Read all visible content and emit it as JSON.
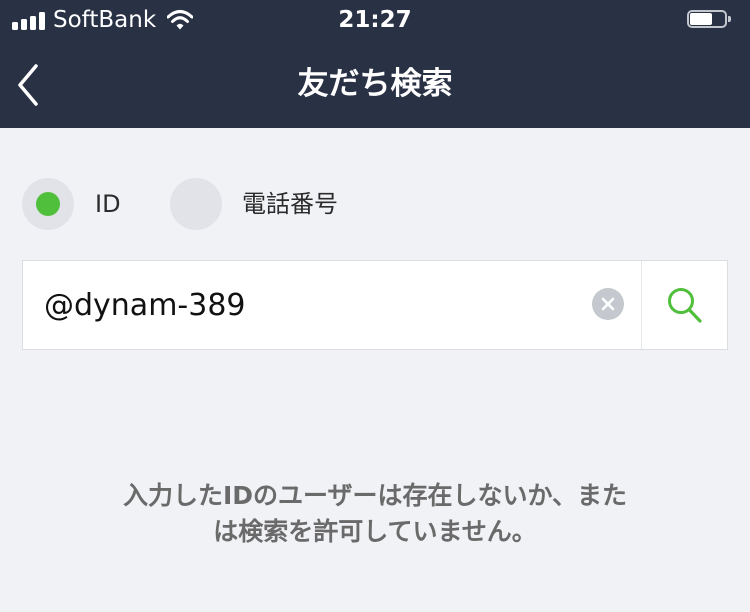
{
  "status_bar": {
    "carrier": "SoftBank",
    "time": "21:27",
    "icons": [
      "signal-icon",
      "wifi-icon",
      "battery-icon"
    ]
  },
  "header": {
    "title": "友だち検索",
    "back_icon": "chevron-left-icon"
  },
  "search_type": {
    "options": [
      {
        "label": "ID",
        "selected": true
      },
      {
        "label": "電話番号",
        "selected": false
      }
    ]
  },
  "search": {
    "value": "@dynam-389",
    "placeholder": "",
    "clear_icon": "clear-icon",
    "search_icon": "search-icon"
  },
  "result": {
    "line1": "入力したIDのユーザーは存在しないか、また",
    "line2": "は検索を許可していません。"
  },
  "colors": {
    "header_bg": "#293145",
    "page_bg": "#f1f2f6",
    "accent": "#4fbf3c",
    "message_text": "#6a6a6a"
  }
}
